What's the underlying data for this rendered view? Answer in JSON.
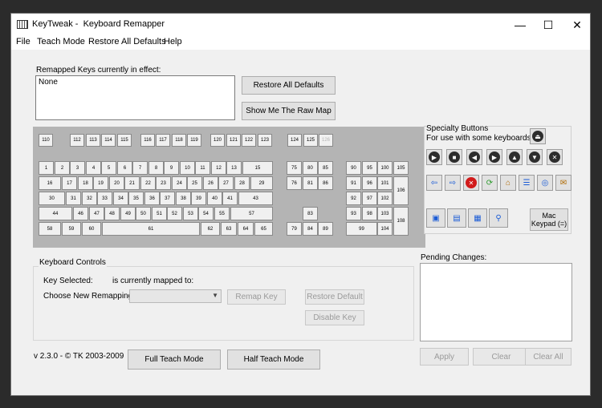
{
  "window": {
    "title": "KeyTweak -  Keyboard Remapper",
    "minimize_glyph": "—",
    "maximize_glyph": "☐",
    "close_glyph": "✕"
  },
  "menu": [
    "File",
    "Teach Mode",
    "Restore All Defaults",
    "Help"
  ],
  "remapped": {
    "label": "Remapped Keys currently in effect:",
    "value": "None"
  },
  "buttons": {
    "restore_all": "Restore All Defaults",
    "raw_map": "Show Me The Raw Map",
    "remap_key": "Remap Key",
    "restore_default": "Restore Default",
    "disable_key": "Disable Key",
    "full_teach": "Full Teach Mode",
    "half_teach": "Half Teach Mode",
    "apply": "Apply",
    "clear": "Clear",
    "clear_all": "Clear All"
  },
  "keys": {
    "fn_row": [
      "110",
      "112",
      "113",
      "114",
      "115",
      "116",
      "117",
      "118",
      "119",
      "120",
      "121",
      "122",
      "123"
    ],
    "print_row": [
      "124",
      "125",
      "126"
    ],
    "row1": [
      "1",
      "2",
      "3",
      "4",
      "5",
      "6",
      "7",
      "8",
      "9",
      "10",
      "11",
      "12",
      "13",
      "15"
    ],
    "row2": [
      "16",
      "17",
      "18",
      "19",
      "20",
      "21",
      "22",
      "23",
      "24",
      "25",
      "26",
      "27",
      "28",
      "29"
    ],
    "row3": [
      "30",
      "31",
      "32",
      "33",
      "34",
      "35",
      "36",
      "37",
      "38",
      "39",
      "40",
      "41",
      "43"
    ],
    "row4": [
      "44",
      "46",
      "47",
      "48",
      "49",
      "50",
      "51",
      "52",
      "53",
      "54",
      "55",
      "57"
    ],
    "row5": [
      "58",
      "59",
      "60",
      "61",
      "62",
      "63",
      "64",
      "65"
    ],
    "nav1": [
      "75",
      "80",
      "85"
    ],
    "nav2": [
      "76",
      "81",
      "86"
    ],
    "arrows": [
      "83",
      "79",
      "84",
      "89"
    ],
    "num1": [
      "90",
      "95",
      "100",
      "105"
    ],
    "num2": [
      "91",
      "96",
      "101",
      "106"
    ],
    "num3": [
      "92",
      "97",
      "102"
    ],
    "num4": [
      "93",
      "98",
      "103",
      "108"
    ],
    "num5": [
      "99",
      "104"
    ]
  },
  "specialty": {
    "title": "Specialty Buttons",
    "subtitle": "For use with some keyboards",
    "mac_keypad": "Mac Keypad (=)",
    "row1_icons": [
      "play-icon",
      "stop-icon",
      "previous-track-icon",
      "next-track-icon",
      "volume-up-icon",
      "volume-down-icon",
      "mute-icon"
    ],
    "row2_icons": [
      "back-arrow-icon",
      "forward-arrow-icon",
      "stop-page-icon",
      "refresh-icon",
      "home-icon",
      "favorites-icon",
      "web-icon",
      "mail-icon"
    ],
    "row3_icons": [
      "media-icon",
      "my-computer-icon",
      "calculator-icon",
      "search-icon"
    ],
    "eject_icon": "eject-icon",
    "colors": {
      "dark": "#2d2d2d",
      "blue": "#1a5bd6",
      "red": "#d11a1a",
      "green": "#2b9a2b"
    }
  },
  "controls": {
    "title": "Keyboard Controls",
    "key_selected": "Key Selected:",
    "mapped_to": "is currently mapped to:",
    "choose": "Choose New Remapping"
  },
  "pending": {
    "label": "Pending Changes:"
  },
  "version": "v 2.3.0 - © TK 2003-2009"
}
